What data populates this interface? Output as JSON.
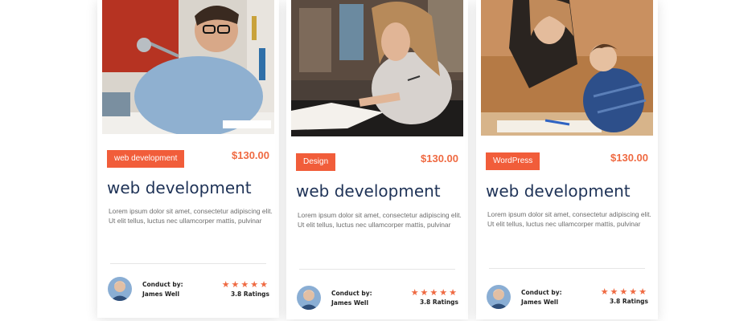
{
  "colors": {
    "accent": "#f15d3a",
    "title": "#1f3357",
    "text": "#6d6d6d"
  },
  "cards": [
    {
      "tag": "web development",
      "price": "$130.00",
      "title": "web development",
      "description": "Lorem ipsum dolor sit amet, consectetur adipiscing elit. Ut elit tellus, luctus nec ullamcorper mattis, pulvinar",
      "conduct_label": "Conduct by:",
      "instructor": "James Well",
      "stars": "★★★★★",
      "ratings": "3.8 Ratings",
      "rating_value": 5
    },
    {
      "tag": "Design",
      "price": "$130.00",
      "title": "web development",
      "description": "Lorem ipsum dolor sit amet, consectetur adipiscing elit. Ut elit tellus, luctus nec ullamcorper mattis, pulvinar",
      "conduct_label": "Conduct by:",
      "instructor": "James Well",
      "stars": "★★★★★",
      "ratings": "3.8 Ratings",
      "rating_value": 5
    },
    {
      "tag": "WordPress",
      "price": "$130.00",
      "title": "web development",
      "description": "Lorem ipsum dolor sit amet, consectetur adipiscing elit. Ut elit tellus, luctus nec ullamcorper mattis, pulvinar",
      "conduct_label": "Conduct by:",
      "instructor": "James Well",
      "stars": "★★★★★",
      "ratings": "3.8 Ratings",
      "rating_value": 4.5
    }
  ]
}
